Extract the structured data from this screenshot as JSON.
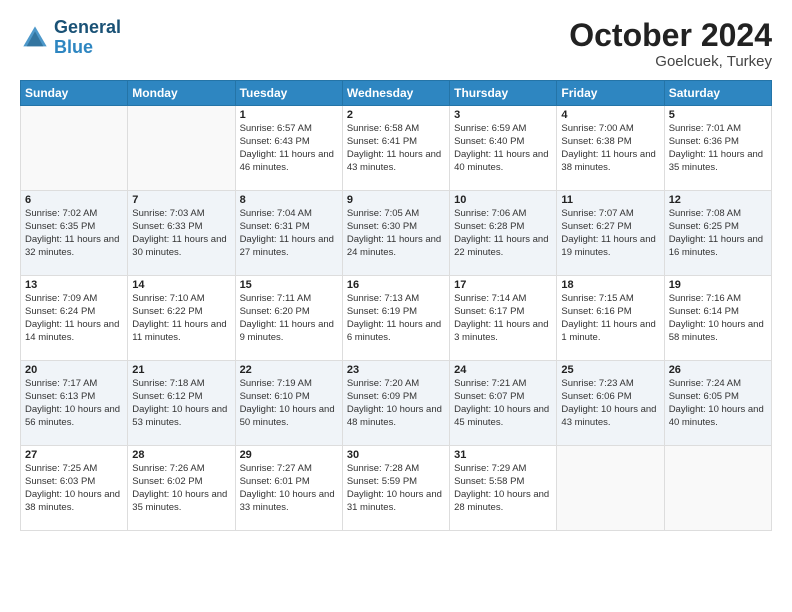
{
  "header": {
    "logo_line1": "General",
    "logo_line2": "Blue",
    "month": "October 2024",
    "location": "Goelcuek, Turkey"
  },
  "weekdays": [
    "Sunday",
    "Monday",
    "Tuesday",
    "Wednesday",
    "Thursday",
    "Friday",
    "Saturday"
  ],
  "rows": [
    [
      {
        "day": "",
        "sunrise": "",
        "sunset": "",
        "daylight": "",
        "empty": true
      },
      {
        "day": "",
        "sunrise": "",
        "sunset": "",
        "daylight": "",
        "empty": true
      },
      {
        "day": "1",
        "sunrise": "Sunrise: 6:57 AM",
        "sunset": "Sunset: 6:43 PM",
        "daylight": "Daylight: 11 hours and 46 minutes.",
        "empty": false
      },
      {
        "day": "2",
        "sunrise": "Sunrise: 6:58 AM",
        "sunset": "Sunset: 6:41 PM",
        "daylight": "Daylight: 11 hours and 43 minutes.",
        "empty": false
      },
      {
        "day": "3",
        "sunrise": "Sunrise: 6:59 AM",
        "sunset": "Sunset: 6:40 PM",
        "daylight": "Daylight: 11 hours and 40 minutes.",
        "empty": false
      },
      {
        "day": "4",
        "sunrise": "Sunrise: 7:00 AM",
        "sunset": "Sunset: 6:38 PM",
        "daylight": "Daylight: 11 hours and 38 minutes.",
        "empty": false
      },
      {
        "day": "5",
        "sunrise": "Sunrise: 7:01 AM",
        "sunset": "Sunset: 6:36 PM",
        "daylight": "Daylight: 11 hours and 35 minutes.",
        "empty": false
      }
    ],
    [
      {
        "day": "6",
        "sunrise": "Sunrise: 7:02 AM",
        "sunset": "Sunset: 6:35 PM",
        "daylight": "Daylight: 11 hours and 32 minutes.",
        "empty": false
      },
      {
        "day": "7",
        "sunrise": "Sunrise: 7:03 AM",
        "sunset": "Sunset: 6:33 PM",
        "daylight": "Daylight: 11 hours and 30 minutes.",
        "empty": false
      },
      {
        "day": "8",
        "sunrise": "Sunrise: 7:04 AM",
        "sunset": "Sunset: 6:31 PM",
        "daylight": "Daylight: 11 hours and 27 minutes.",
        "empty": false
      },
      {
        "day": "9",
        "sunrise": "Sunrise: 7:05 AM",
        "sunset": "Sunset: 6:30 PM",
        "daylight": "Daylight: 11 hours and 24 minutes.",
        "empty": false
      },
      {
        "day": "10",
        "sunrise": "Sunrise: 7:06 AM",
        "sunset": "Sunset: 6:28 PM",
        "daylight": "Daylight: 11 hours and 22 minutes.",
        "empty": false
      },
      {
        "day": "11",
        "sunrise": "Sunrise: 7:07 AM",
        "sunset": "Sunset: 6:27 PM",
        "daylight": "Daylight: 11 hours and 19 minutes.",
        "empty": false
      },
      {
        "day": "12",
        "sunrise": "Sunrise: 7:08 AM",
        "sunset": "Sunset: 6:25 PM",
        "daylight": "Daylight: 11 hours and 16 minutes.",
        "empty": false
      }
    ],
    [
      {
        "day": "13",
        "sunrise": "Sunrise: 7:09 AM",
        "sunset": "Sunset: 6:24 PM",
        "daylight": "Daylight: 11 hours and 14 minutes.",
        "empty": false
      },
      {
        "day": "14",
        "sunrise": "Sunrise: 7:10 AM",
        "sunset": "Sunset: 6:22 PM",
        "daylight": "Daylight: 11 hours and 11 minutes.",
        "empty": false
      },
      {
        "day": "15",
        "sunrise": "Sunrise: 7:11 AM",
        "sunset": "Sunset: 6:20 PM",
        "daylight": "Daylight: 11 hours and 9 minutes.",
        "empty": false
      },
      {
        "day": "16",
        "sunrise": "Sunrise: 7:13 AM",
        "sunset": "Sunset: 6:19 PM",
        "daylight": "Daylight: 11 hours and 6 minutes.",
        "empty": false
      },
      {
        "day": "17",
        "sunrise": "Sunrise: 7:14 AM",
        "sunset": "Sunset: 6:17 PM",
        "daylight": "Daylight: 11 hours and 3 minutes.",
        "empty": false
      },
      {
        "day": "18",
        "sunrise": "Sunrise: 7:15 AM",
        "sunset": "Sunset: 6:16 PM",
        "daylight": "Daylight: 11 hours and 1 minute.",
        "empty": false
      },
      {
        "day": "19",
        "sunrise": "Sunrise: 7:16 AM",
        "sunset": "Sunset: 6:14 PM",
        "daylight": "Daylight: 10 hours and 58 minutes.",
        "empty": false
      }
    ],
    [
      {
        "day": "20",
        "sunrise": "Sunrise: 7:17 AM",
        "sunset": "Sunset: 6:13 PM",
        "daylight": "Daylight: 10 hours and 56 minutes.",
        "empty": false
      },
      {
        "day": "21",
        "sunrise": "Sunrise: 7:18 AM",
        "sunset": "Sunset: 6:12 PM",
        "daylight": "Daylight: 10 hours and 53 minutes.",
        "empty": false
      },
      {
        "day": "22",
        "sunrise": "Sunrise: 7:19 AM",
        "sunset": "Sunset: 6:10 PM",
        "daylight": "Daylight: 10 hours and 50 minutes.",
        "empty": false
      },
      {
        "day": "23",
        "sunrise": "Sunrise: 7:20 AM",
        "sunset": "Sunset: 6:09 PM",
        "daylight": "Daylight: 10 hours and 48 minutes.",
        "empty": false
      },
      {
        "day": "24",
        "sunrise": "Sunrise: 7:21 AM",
        "sunset": "Sunset: 6:07 PM",
        "daylight": "Daylight: 10 hours and 45 minutes.",
        "empty": false
      },
      {
        "day": "25",
        "sunrise": "Sunrise: 7:23 AM",
        "sunset": "Sunset: 6:06 PM",
        "daylight": "Daylight: 10 hours and 43 minutes.",
        "empty": false
      },
      {
        "day": "26",
        "sunrise": "Sunrise: 7:24 AM",
        "sunset": "Sunset: 6:05 PM",
        "daylight": "Daylight: 10 hours and 40 minutes.",
        "empty": false
      }
    ],
    [
      {
        "day": "27",
        "sunrise": "Sunrise: 7:25 AM",
        "sunset": "Sunset: 6:03 PM",
        "daylight": "Daylight: 10 hours and 38 minutes.",
        "empty": false
      },
      {
        "day": "28",
        "sunrise": "Sunrise: 7:26 AM",
        "sunset": "Sunset: 6:02 PM",
        "daylight": "Daylight: 10 hours and 35 minutes.",
        "empty": false
      },
      {
        "day": "29",
        "sunrise": "Sunrise: 7:27 AM",
        "sunset": "Sunset: 6:01 PM",
        "daylight": "Daylight: 10 hours and 33 minutes.",
        "empty": false
      },
      {
        "day": "30",
        "sunrise": "Sunrise: 7:28 AM",
        "sunset": "Sunset: 5:59 PM",
        "daylight": "Daylight: 10 hours and 31 minutes.",
        "empty": false
      },
      {
        "day": "31",
        "sunrise": "Sunrise: 7:29 AM",
        "sunset": "Sunset: 5:58 PM",
        "daylight": "Daylight: 10 hours and 28 minutes.",
        "empty": false
      },
      {
        "day": "",
        "sunrise": "",
        "sunset": "",
        "daylight": "",
        "empty": true
      },
      {
        "day": "",
        "sunrise": "",
        "sunset": "",
        "daylight": "",
        "empty": true
      }
    ]
  ]
}
